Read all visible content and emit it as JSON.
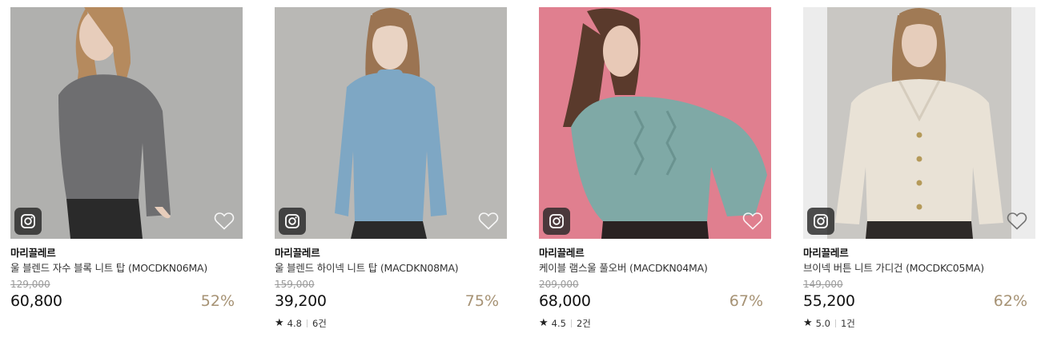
{
  "products": [
    {
      "brand": "마리끌레르",
      "name": "울 블렌드 자수 블록 니트 탑 (MOCDKN06MA)",
      "original_price": "129,000",
      "price": "60,800",
      "discount": "52%",
      "rating": null,
      "reviews": null,
      "image_colors": {
        "bg": "#a8a8a6",
        "garment": "#6e6e70",
        "hair": "#b58a5e",
        "pants": "#2a2a2a"
      }
    },
    {
      "brand": "마리끌레르",
      "name": "울 블렌드 하이넥 니트 탑 (MACDKN08MA)",
      "original_price": "159,000",
      "price": "39,200",
      "discount": "75%",
      "rating": "4.8",
      "reviews": "6건",
      "image_colors": {
        "bg": "#b9b8b5",
        "garment": "#7ea7c4",
        "hair": "#9b7452",
        "pants": "#2a2a2a"
      }
    },
    {
      "brand": "마리끌레르",
      "name": "케이블 램스울 풀오버 (MACDKN04MA)",
      "original_price": "209,000",
      "price": "68,000",
      "discount": "67%",
      "rating": "4.5",
      "reviews": "2건",
      "image_colors": {
        "bg": "#e07f8f",
        "garment": "#7fa9a6",
        "hair": "#5a3a2c",
        "pants": "#2a2222"
      }
    },
    {
      "brand": "마리끌레르",
      "name": "브이넥 버튼 니트 가디건 (MOCDKC05MA)",
      "original_price": "149,000",
      "price": "55,200",
      "discount": "62%",
      "rating": "5.0",
      "reviews": "1건",
      "image_colors": {
        "bg": "#c9c7c3",
        "garment": "#e9e2d6",
        "hair": "#a07a55",
        "pants": "#2e2a28"
      }
    }
  ],
  "icons": {
    "instagram": "instagram-icon",
    "wishlist": "heart-outline-icon",
    "rating": "star-icon"
  }
}
